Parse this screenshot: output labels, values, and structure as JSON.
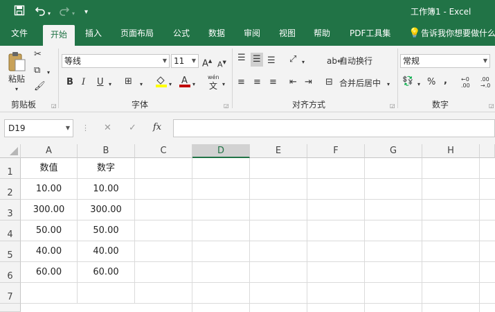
{
  "window": {
    "title": "工作簿1  -  Excel"
  },
  "quick_access": {
    "save_icon": "save-icon",
    "undo_icon": "undo-icon",
    "redo_icon": "redo-icon",
    "customize_icon": "customize-icon"
  },
  "tabs": [
    {
      "label": "文件"
    },
    {
      "label": "开始",
      "active": true
    },
    {
      "label": "插入"
    },
    {
      "label": "页面布局"
    },
    {
      "label": "公式"
    },
    {
      "label": "数据"
    },
    {
      "label": "审阅"
    },
    {
      "label": "视图"
    },
    {
      "label": "帮助"
    },
    {
      "label": "PDF工具集"
    }
  ],
  "tell_me": "告诉我你想要做什么",
  "ribbon": {
    "clipboard": {
      "paste_label": "粘贴",
      "group_label": "剪贴板"
    },
    "font": {
      "font_name": "等线",
      "font_size": "11",
      "bold": "B",
      "italic": "I",
      "underline": "U",
      "group_label": "字体",
      "wen": "wén",
      "wen_char": "文"
    },
    "alignment": {
      "wrap_label": "自动换行",
      "merge_label": "合并后居中",
      "group_label": "对齐方式"
    },
    "number": {
      "format": "常规",
      "percent": "%",
      "comma": ",",
      "group_label": "数字"
    }
  },
  "formula_bar": {
    "name_box": "D19",
    "cancel": "✕",
    "enter": "✓",
    "fx": "fx",
    "value": ""
  },
  "colors": {
    "accent": "#217346",
    "ribbon_bg": "#f3f3f3",
    "font_color": "#c00000",
    "fill_color": "#ffff00"
  },
  "columns": [
    "A",
    "B",
    "C",
    "D",
    "E",
    "F",
    "G",
    "H"
  ],
  "selected_column": "D",
  "rows": [
    {
      "num": "1",
      "a": "数值",
      "b": "数字"
    },
    {
      "num": "2",
      "a": "10.00",
      "b": "10.00"
    },
    {
      "num": "3",
      "a": "300.00",
      "b": "300.00"
    },
    {
      "num": "4",
      "a": "50.00",
      "b": "50.00"
    },
    {
      "num": "5",
      "a": "40.00",
      "b": "40.00"
    },
    {
      "num": "6",
      "a": "60.00",
      "b": "60.00"
    },
    {
      "num": "7",
      "a": "",
      "b": ""
    }
  ]
}
